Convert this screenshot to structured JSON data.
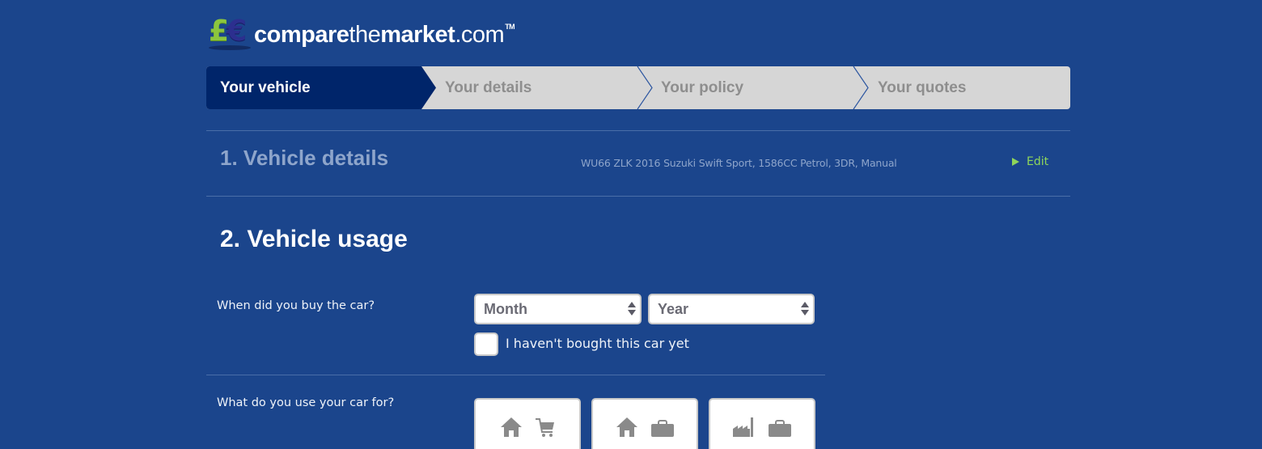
{
  "brand": {
    "logo_parts": [
      "compare",
      "the",
      "market",
      ".com"
    ],
    "trademark": "TM",
    "logo_icon": "pound-euro-coins-icon"
  },
  "steps": [
    {
      "label": "Your vehicle",
      "active": true
    },
    {
      "label": "Your details",
      "active": false
    },
    {
      "label": "Your policy",
      "active": false
    },
    {
      "label": "Your quotes",
      "active": false
    }
  ],
  "section1": {
    "title": "1. Vehicle details",
    "summary": "WU66 ZLK 2016 Suzuki Swift Sport, 1586CC Petrol, 3DR, Manual",
    "edit_label": "Edit"
  },
  "section2": {
    "title": "2. Vehicle usage",
    "purchase_question": "When did you buy the car?",
    "month_select": {
      "value": "Month"
    },
    "year_select": {
      "value": "Year"
    },
    "not_bought_checkbox": {
      "label": "I haven't bought this car yet",
      "checked": false
    },
    "usage_question": "What do you use your car for?",
    "usage_options": [
      {
        "icons": [
          "home-icon",
          "shopping-cart-icon"
        ]
      },
      {
        "icons": [
          "home-icon",
          "briefcase-icon"
        ]
      },
      {
        "icons": [
          "factory-icon",
          "briefcase-icon"
        ]
      }
    ]
  },
  "colors": {
    "background": "#1b458c",
    "active_step": "#00256a",
    "inactive_step": "#d6d6d6",
    "edit_link": "#8fd65a",
    "muted_text": "#8ea5cb"
  }
}
